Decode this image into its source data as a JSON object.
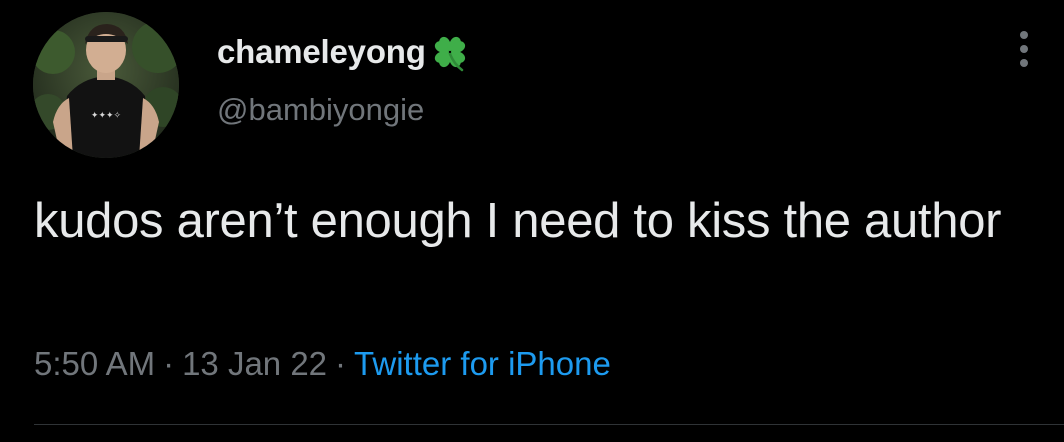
{
  "author": {
    "display_name": "chameleyong",
    "handle": "@bambiyongie",
    "name_emoji_icon": "four-leaf-clover-icon"
  },
  "tweet": {
    "text": "kudos aren’t enough I need to kiss the author",
    "time": "5:50 AM",
    "date": "13 Jan 22",
    "separator": "·",
    "source": "Twitter for iPhone"
  },
  "colors": {
    "background": "#000000",
    "primary_text": "#e7e9ea",
    "secondary_text": "#71767b",
    "link": "#1d9bf0",
    "clover": "#3fae49",
    "divider": "#2f3336"
  },
  "icons": {
    "more": "more-vertical-icon"
  }
}
